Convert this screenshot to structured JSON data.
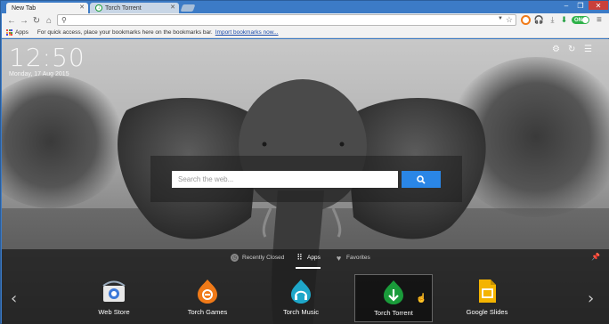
{
  "browser": {
    "tabs": [
      {
        "label": "New Tab",
        "active": true
      },
      {
        "label": "Torch Torrent",
        "active": false
      }
    ],
    "toggle_label": "ON"
  },
  "bookmarks_bar": {
    "apps_label": "Apps",
    "prompt_text": "For quick access, place your bookmarks here on the bookmarks bar.",
    "import_link": "Import bookmarks now..."
  },
  "newtab": {
    "time": "12:50",
    "date": "Monday, 17 Aug 2015",
    "search_placeholder": "Search the web...",
    "dock_tabs": [
      {
        "label": "Recently Closed",
        "active": false
      },
      {
        "label": "Apps",
        "active": true
      },
      {
        "label": "Favorites",
        "active": false
      }
    ],
    "apps": [
      {
        "label": "Web Store",
        "icon": "web-store-icon"
      },
      {
        "label": "Torch Games",
        "icon": "torch-games-icon"
      },
      {
        "label": "Torch Music",
        "icon": "torch-music-icon"
      },
      {
        "label": "Torch Torrent",
        "icon": "torch-torrent-icon"
      },
      {
        "label": "Google Slides",
        "icon": "google-slides-icon"
      }
    ]
  },
  "colors": {
    "tab_strip": "#3c7bc6",
    "search_button": "#2a86e6",
    "torch_orange": "#f07a18",
    "music_blue": "#1ea7c9",
    "torrent_green": "#1a9b3a",
    "slides_yellow": "#f4b400"
  }
}
